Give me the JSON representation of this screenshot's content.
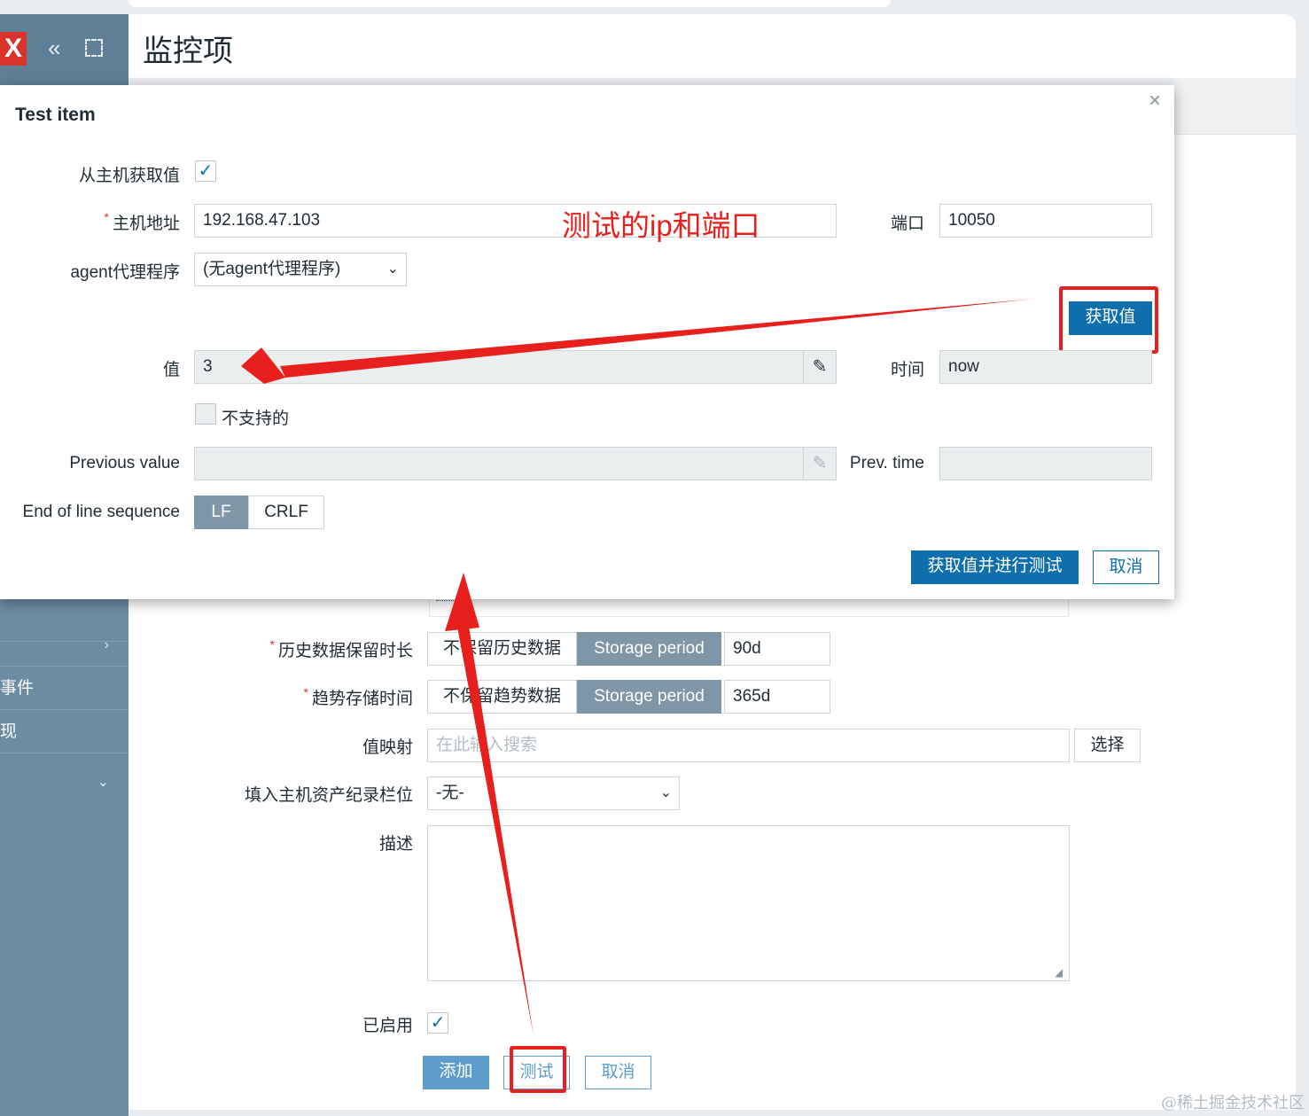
{
  "page": {
    "title": "监控项",
    "watermark": "@稀土掘金技术社区"
  },
  "sidebar": {
    "logo": "X",
    "items": [
      {
        "label": ""
      },
      {
        "label": "事件"
      },
      {
        "label": "现"
      },
      {
        "label": ""
      }
    ]
  },
  "form": {
    "history": {
      "label": "历史数据保留时长",
      "option_none": "不保留历史数据",
      "option_period": "Storage period",
      "value": "90d"
    },
    "trends": {
      "label": "趋势存储时间",
      "option_none": "不保留趋势数据",
      "option_period": "Storage period",
      "value": "365d"
    },
    "valuemap": {
      "label": "值映射",
      "placeholder": "在此输入搜索",
      "select_button": "选择"
    },
    "inventory": {
      "label": "填入主机资产纪录栏位",
      "value": "-无-"
    },
    "description": {
      "label": "描述",
      "value": ""
    },
    "enabled": {
      "label": "已启用",
      "checked": true
    },
    "buttons": {
      "add": "添加",
      "test": "测试",
      "cancel": "取消"
    }
  },
  "modal": {
    "title": "Test item",
    "close": "×",
    "get_from_host": {
      "label": "从主机获取值",
      "checked": true
    },
    "host_address": {
      "label": "主机地址",
      "value": "192.168.47.103"
    },
    "port": {
      "label": "端口",
      "value": "10050"
    },
    "proxy": {
      "label": "agent代理程序",
      "value": "(无agent代理程序)"
    },
    "get_value_button": "获取值",
    "value": {
      "label": "值",
      "value": "3"
    },
    "time": {
      "label": "时间",
      "value": "now"
    },
    "not_supported": {
      "label": "不支持的",
      "checked": false
    },
    "previous_value": {
      "label": "Previous value",
      "value": ""
    },
    "prev_time": {
      "label": "Prev. time",
      "value": ""
    },
    "eol": {
      "label": "End of line sequence",
      "options": [
        "LF",
        "CRLF"
      ],
      "selected": "LF"
    },
    "buttons": {
      "get_and_test": "获取值并进行测试",
      "cancel": "取消"
    }
  },
  "annotation": {
    "note": "测试的ip和端口",
    "color": "#e8201d"
  },
  "colors": {
    "primary": "#0f6fad",
    "sidebar": "#6b8ca3",
    "logo": "#d9342b"
  }
}
